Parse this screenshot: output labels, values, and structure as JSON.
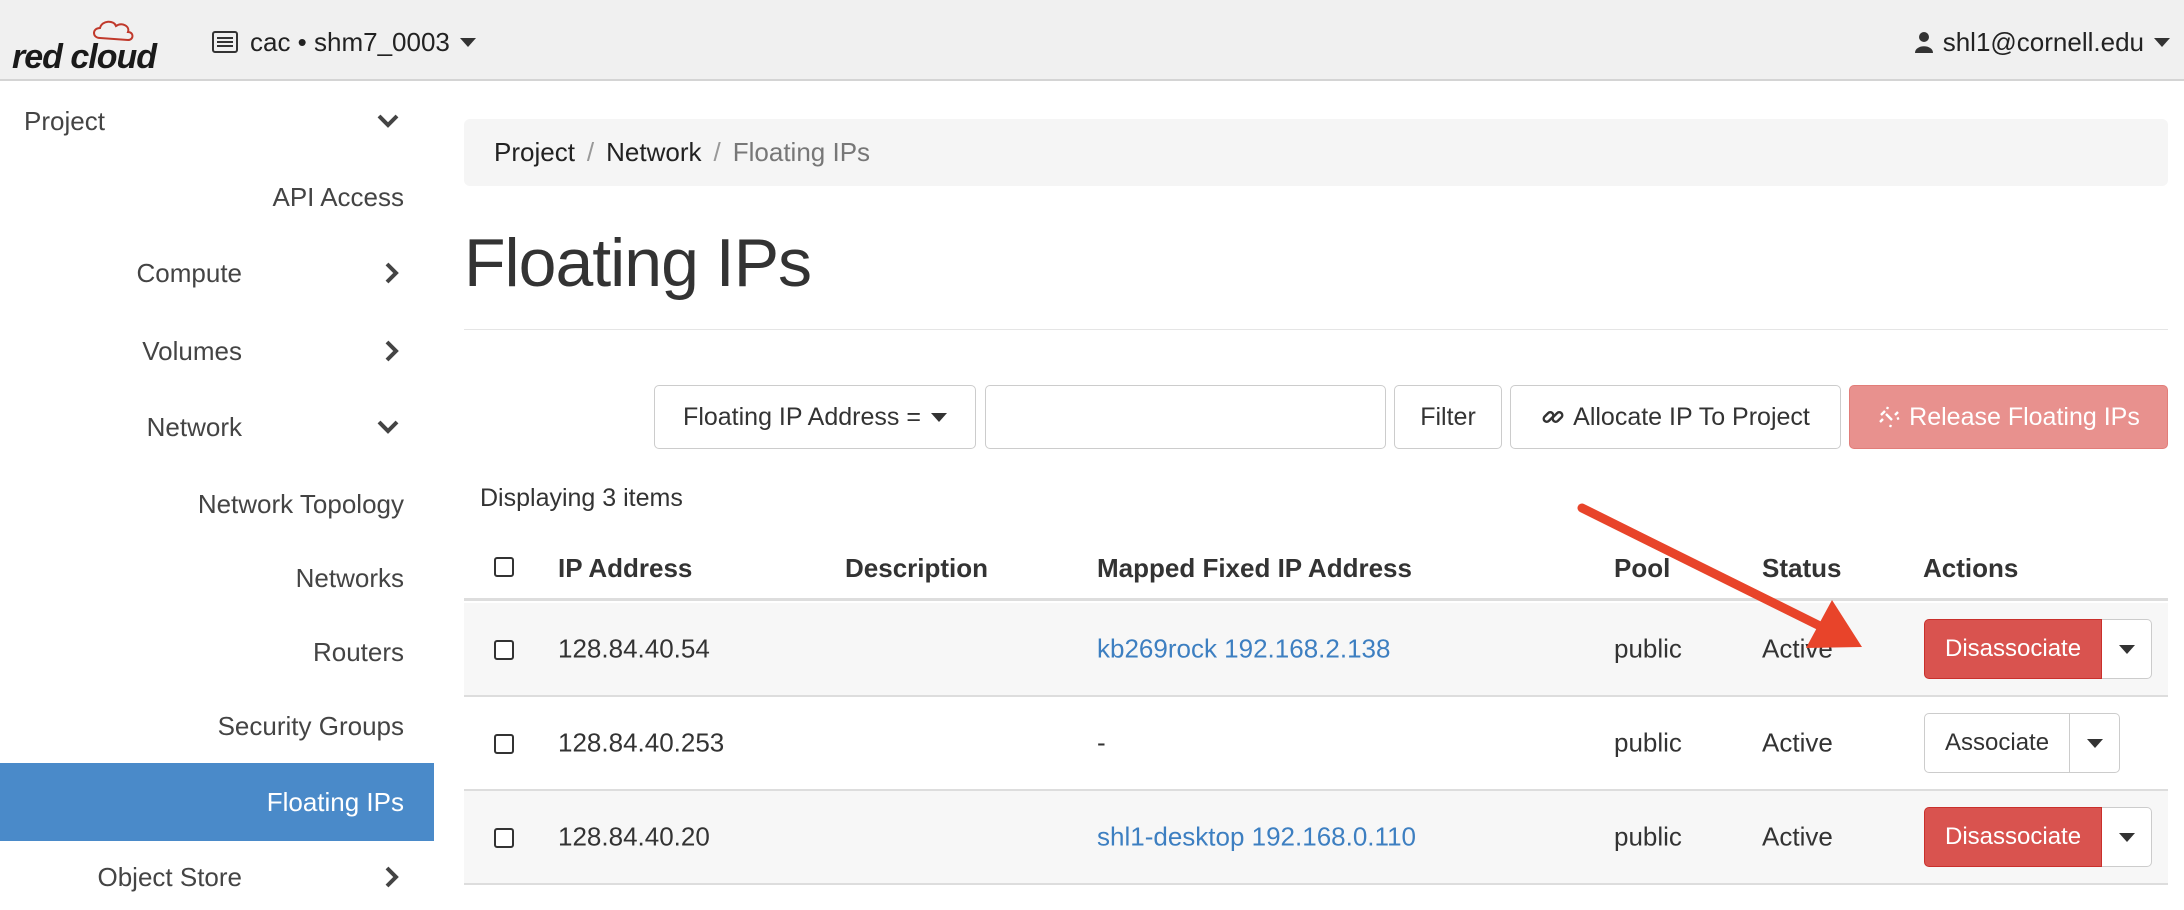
{
  "header": {
    "logo_text": "red cloud",
    "project_label": "cac • shm7_0003",
    "user_label": "shl1@cornell.edu"
  },
  "sidebar": {
    "items": [
      {
        "label": "Project",
        "level": 0,
        "chevron": "down"
      },
      {
        "label": "API Access",
        "level": 2
      },
      {
        "label": "Compute",
        "level": 1,
        "chevron": "right"
      },
      {
        "label": "Volumes",
        "level": 1,
        "chevron": "right"
      },
      {
        "label": "Network",
        "level": 1,
        "chevron": "down"
      },
      {
        "label": "Network Topology",
        "level": 2
      },
      {
        "label": "Networks",
        "level": 2
      },
      {
        "label": "Routers",
        "level": 2
      },
      {
        "label": "Security Groups",
        "level": 2
      },
      {
        "label": "Floating IPs",
        "level": 2,
        "active": true
      },
      {
        "label": "Object Store",
        "level": 1,
        "chevron": "right"
      }
    ]
  },
  "breadcrumb": {
    "items": [
      "Project",
      "Network"
    ],
    "current": "Floating IPs",
    "separator": "/"
  },
  "page": {
    "title": "Floating IPs"
  },
  "toolbar": {
    "filter_select": "Floating IP Address =",
    "filter_input_value": "",
    "filter_button": "Filter",
    "allocate_button": "Allocate IP To Project",
    "release_button": "Release Floating IPs"
  },
  "table": {
    "display_count": "Displaying 3 items",
    "columns": [
      "IP Address",
      "Description",
      "Mapped Fixed IP Address",
      "Pool",
      "Status",
      "Actions"
    ],
    "rows": [
      {
        "ip": "128.84.40.54",
        "description": "",
        "mapped": "kb269rock 192.168.2.138",
        "pool": "public",
        "status": "Active",
        "action": "Disassociate"
      },
      {
        "ip": "128.84.40.253",
        "description": "",
        "mapped": "-",
        "pool": "public",
        "status": "Active",
        "action": "Associate"
      },
      {
        "ip": "128.84.40.20",
        "description": "",
        "mapped": "shl1-desktop 192.168.0.110",
        "pool": "public",
        "status": "Active",
        "action": "Disassociate"
      }
    ]
  },
  "colors": {
    "active_nav": "#4a8ac9",
    "danger": "#d9534f",
    "danger_disabled": "#e8918e",
    "link": "#3d7fc1",
    "annotation_arrow": "#e8442a"
  }
}
